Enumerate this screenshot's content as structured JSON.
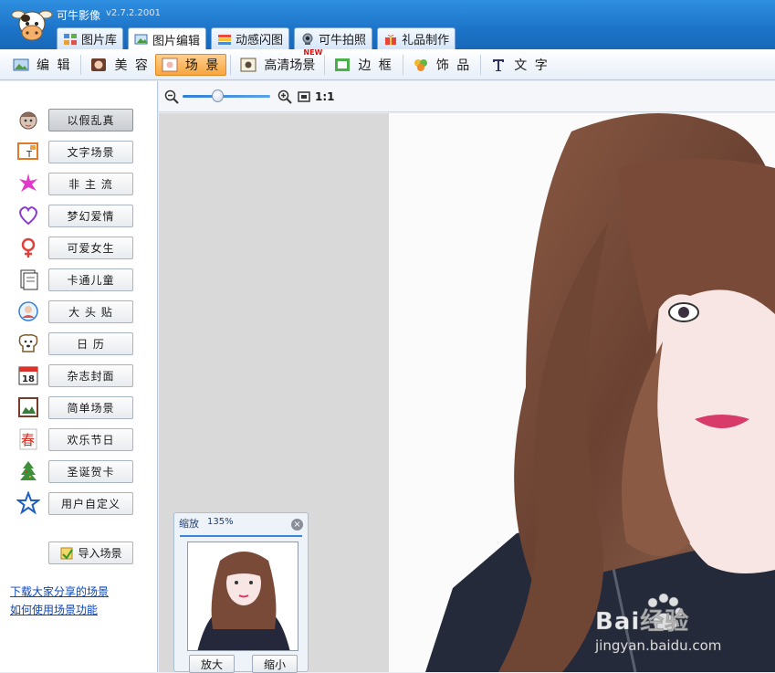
{
  "app": {
    "title": "可牛影像",
    "version": "v2.7.2.2001"
  },
  "tabs": [
    {
      "label": "图片库",
      "icon": "photo-library-icon"
    },
    {
      "label": "图片编辑",
      "icon": "image-edit-icon"
    },
    {
      "label": "动感闪图",
      "icon": "flash-gif-icon"
    },
    {
      "label": "可牛拍照",
      "icon": "webcam-icon"
    },
    {
      "label": "礼品制作",
      "icon": "gift-icon"
    }
  ],
  "subtoolbar": [
    {
      "label": "编 辑",
      "icon": "edit-icon"
    },
    {
      "label": "美 容",
      "icon": "beauty-icon"
    },
    {
      "label": "场 景",
      "icon": "scene-icon",
      "active": true
    },
    {
      "label": "高清场景",
      "icon": "hd-scene-icon",
      "badge": "NEW"
    },
    {
      "label": "边 框",
      "icon": "frame-icon"
    },
    {
      "label": "饰 品",
      "icon": "accessory-icon"
    },
    {
      "label": "文 字",
      "icon": "text-icon"
    }
  ],
  "categories": [
    {
      "label": "以假乱真",
      "icon": "face-icon"
    },
    {
      "label": "文字场景",
      "icon": "text-scene-icon"
    },
    {
      "label": "非 主 流",
      "icon": "sparkle-icon"
    },
    {
      "label": "梦幻爱情",
      "icon": "heart-icon"
    },
    {
      "label": "可爱女生",
      "icon": "female-icon"
    },
    {
      "label": "卡通儿童",
      "icon": "book-icon"
    },
    {
      "label": "大 头 贴",
      "icon": "photo-sticker-icon"
    },
    {
      "label": "日    历",
      "icon": "dog-icon"
    },
    {
      "label": "杂志封面",
      "icon": "calendar-18-icon"
    },
    {
      "label": "简单场景",
      "icon": "simple-frame-icon"
    },
    {
      "label": "欢乐节日",
      "icon": "spring-festival-icon"
    },
    {
      "label": "圣诞贺卡",
      "icon": "christmas-tree-icon"
    },
    {
      "label": "用户自定义",
      "icon": "star-icon"
    }
  ],
  "import_button": "导入场景",
  "links": [
    "下载大家分享的场景",
    "如何使用场景功能"
  ],
  "zoom": {
    "ratio_label": "1:1",
    "level": 0.4
  },
  "navigator": {
    "title": "缩放",
    "percent": "135%",
    "zoom_in": "放大",
    "zoom_out": "缩小"
  },
  "watermark": {
    "brand": "Bai经验",
    "url": "jingyan.baidu.com"
  }
}
